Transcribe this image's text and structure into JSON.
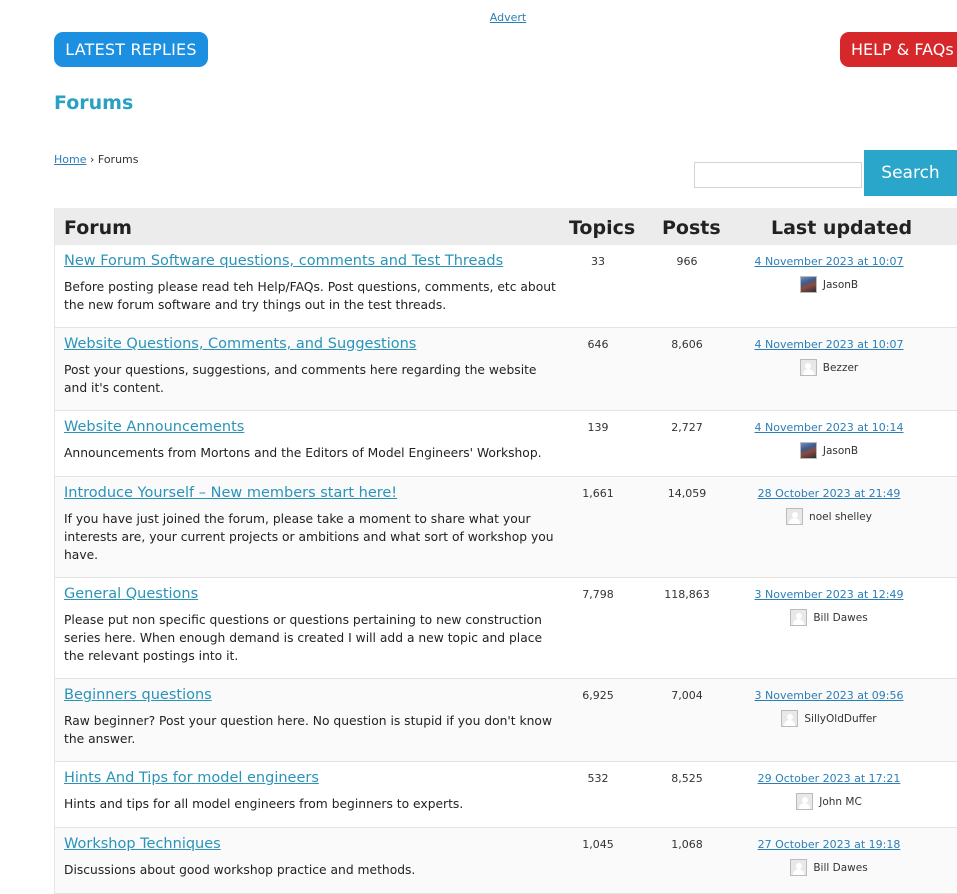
{
  "advert": "Advert",
  "buttons": {
    "latest_replies": "LATEST REPLIES",
    "help_faqs": "HELP & FAQs"
  },
  "page_title": "Forums",
  "breadcrumb": {
    "home": "Home",
    "separator": "›",
    "current": "Forums"
  },
  "search": {
    "placeholder": "",
    "button": "Search"
  },
  "table": {
    "headers": {
      "forum": "Forum",
      "topics": "Topics",
      "posts": "Posts",
      "last_updated": "Last updated"
    },
    "rows": [
      {
        "title": "New Forum Software questions, comments and Test Threads",
        "description": "Before posting please read teh Help/FAQs. Post questions, comments, etc about the new forum software and try things out in the test threads.",
        "topics": "33",
        "posts": "966",
        "last_updated": "4 November 2023 at 10:07",
        "user": "JasonB",
        "avatar": "photo"
      },
      {
        "title": "Website Questions, Comments, and Suggestions",
        "description": "Post your questions, suggestions, and comments here regarding the website and it's content.",
        "topics": "646",
        "posts": "8,606",
        "last_updated": "4 November 2023 at 10:07",
        "user": "Bezzer",
        "avatar": "default"
      },
      {
        "title": "Website Announcements",
        "description": "Announcements from Mortons and the Editors of Model Engineers' Workshop.",
        "topics": "139",
        "posts": "2,727",
        "last_updated": "4 November 2023 at 10:14",
        "user": "JasonB",
        "avatar": "photo"
      },
      {
        "title": "Introduce Yourself – New members start here!",
        "description": "If you have just joined the forum, please take a moment to share what your interests are, your current projects or ambitions and what sort of workshop you have.",
        "topics": "1,661",
        "posts": "14,059",
        "last_updated": "28 October 2023 at 21:49",
        "user": "noel shelley",
        "avatar": "default"
      },
      {
        "title": "General Questions",
        "description": "Please put non specific questions or questions pertaining to new construction series here. When enough demand is created I will add a new topic and place the relevant postings into it.",
        "topics": "7,798",
        "posts": "118,863",
        "last_updated": "3 November 2023 at 12:49",
        "user": "Bill Dawes",
        "avatar": "default"
      },
      {
        "title": "Beginners questions",
        "description": "Raw beginner? Post your question here. No question is stupid if you don't know the answer.",
        "topics": "6,925",
        "posts": "7,004",
        "last_updated": "3 November 2023 at 09:56",
        "user": "SillyOldDuffer",
        "avatar": "default"
      },
      {
        "title": "Hints And Tips for model engineers",
        "description": "Hints and tips for all model engineers from beginners to experts.",
        "topics": "532",
        "posts": "8,525",
        "last_updated": "29 October 2023 at 17:21",
        "user": "John MC",
        "avatar": "default"
      },
      {
        "title": "Workshop Techniques",
        "description": "Discussions about good workshop practice and methods.",
        "topics": "1,045",
        "posts": "1,068",
        "last_updated": "27 October 2023 at 19:18",
        "user": "Bill Dawes",
        "avatar": "default"
      }
    ]
  }
}
